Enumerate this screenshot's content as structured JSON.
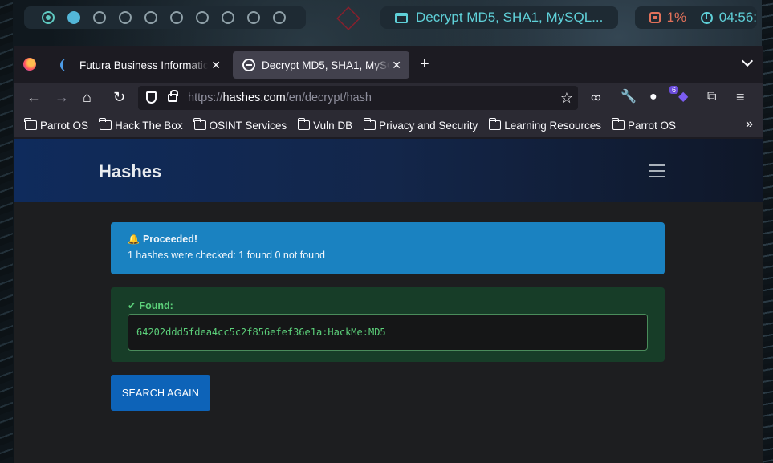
{
  "panel": {
    "workspaces": [
      "1",
      "2",
      "3",
      "4",
      "5",
      "6",
      "7",
      "8",
      "9",
      "10"
    ],
    "window_title": "Decrypt MD5, SHA1, MySQL...",
    "cpu": "1%",
    "clock": "04:56:"
  },
  "browser": {
    "tabs": [
      {
        "title": "Futura Business Informatic"
      },
      {
        "title": "Decrypt MD5, SHA1, MySQ"
      }
    ],
    "url": {
      "scheme": "https://",
      "host": "hashes.com",
      "path": "/en/decrypt/hash"
    },
    "extension_badge": "6",
    "bookmarks": [
      "Parrot OS",
      "Hack The Box",
      "OSINT Services",
      "Vuln DB",
      "Privacy and Security",
      "Learning Resources",
      "Parrot OS"
    ]
  },
  "page": {
    "brand": "Hashes",
    "alert": {
      "title": "Proceeded!",
      "message": "1 hashes were checked: 1 found 0 not found"
    },
    "found": {
      "title": "Found:",
      "result": "64202ddd5fdea4cc5c2f856efef36e1a:HackMe:MD5"
    },
    "search_again_label": "SEARCH AGAIN"
  },
  "colors": {
    "accent_cyan": "#5fd0d8",
    "cpu": "#e2715a",
    "info_alert": "#1a82c1",
    "success_text": "#5cd07a",
    "button": "#0d63b8"
  }
}
